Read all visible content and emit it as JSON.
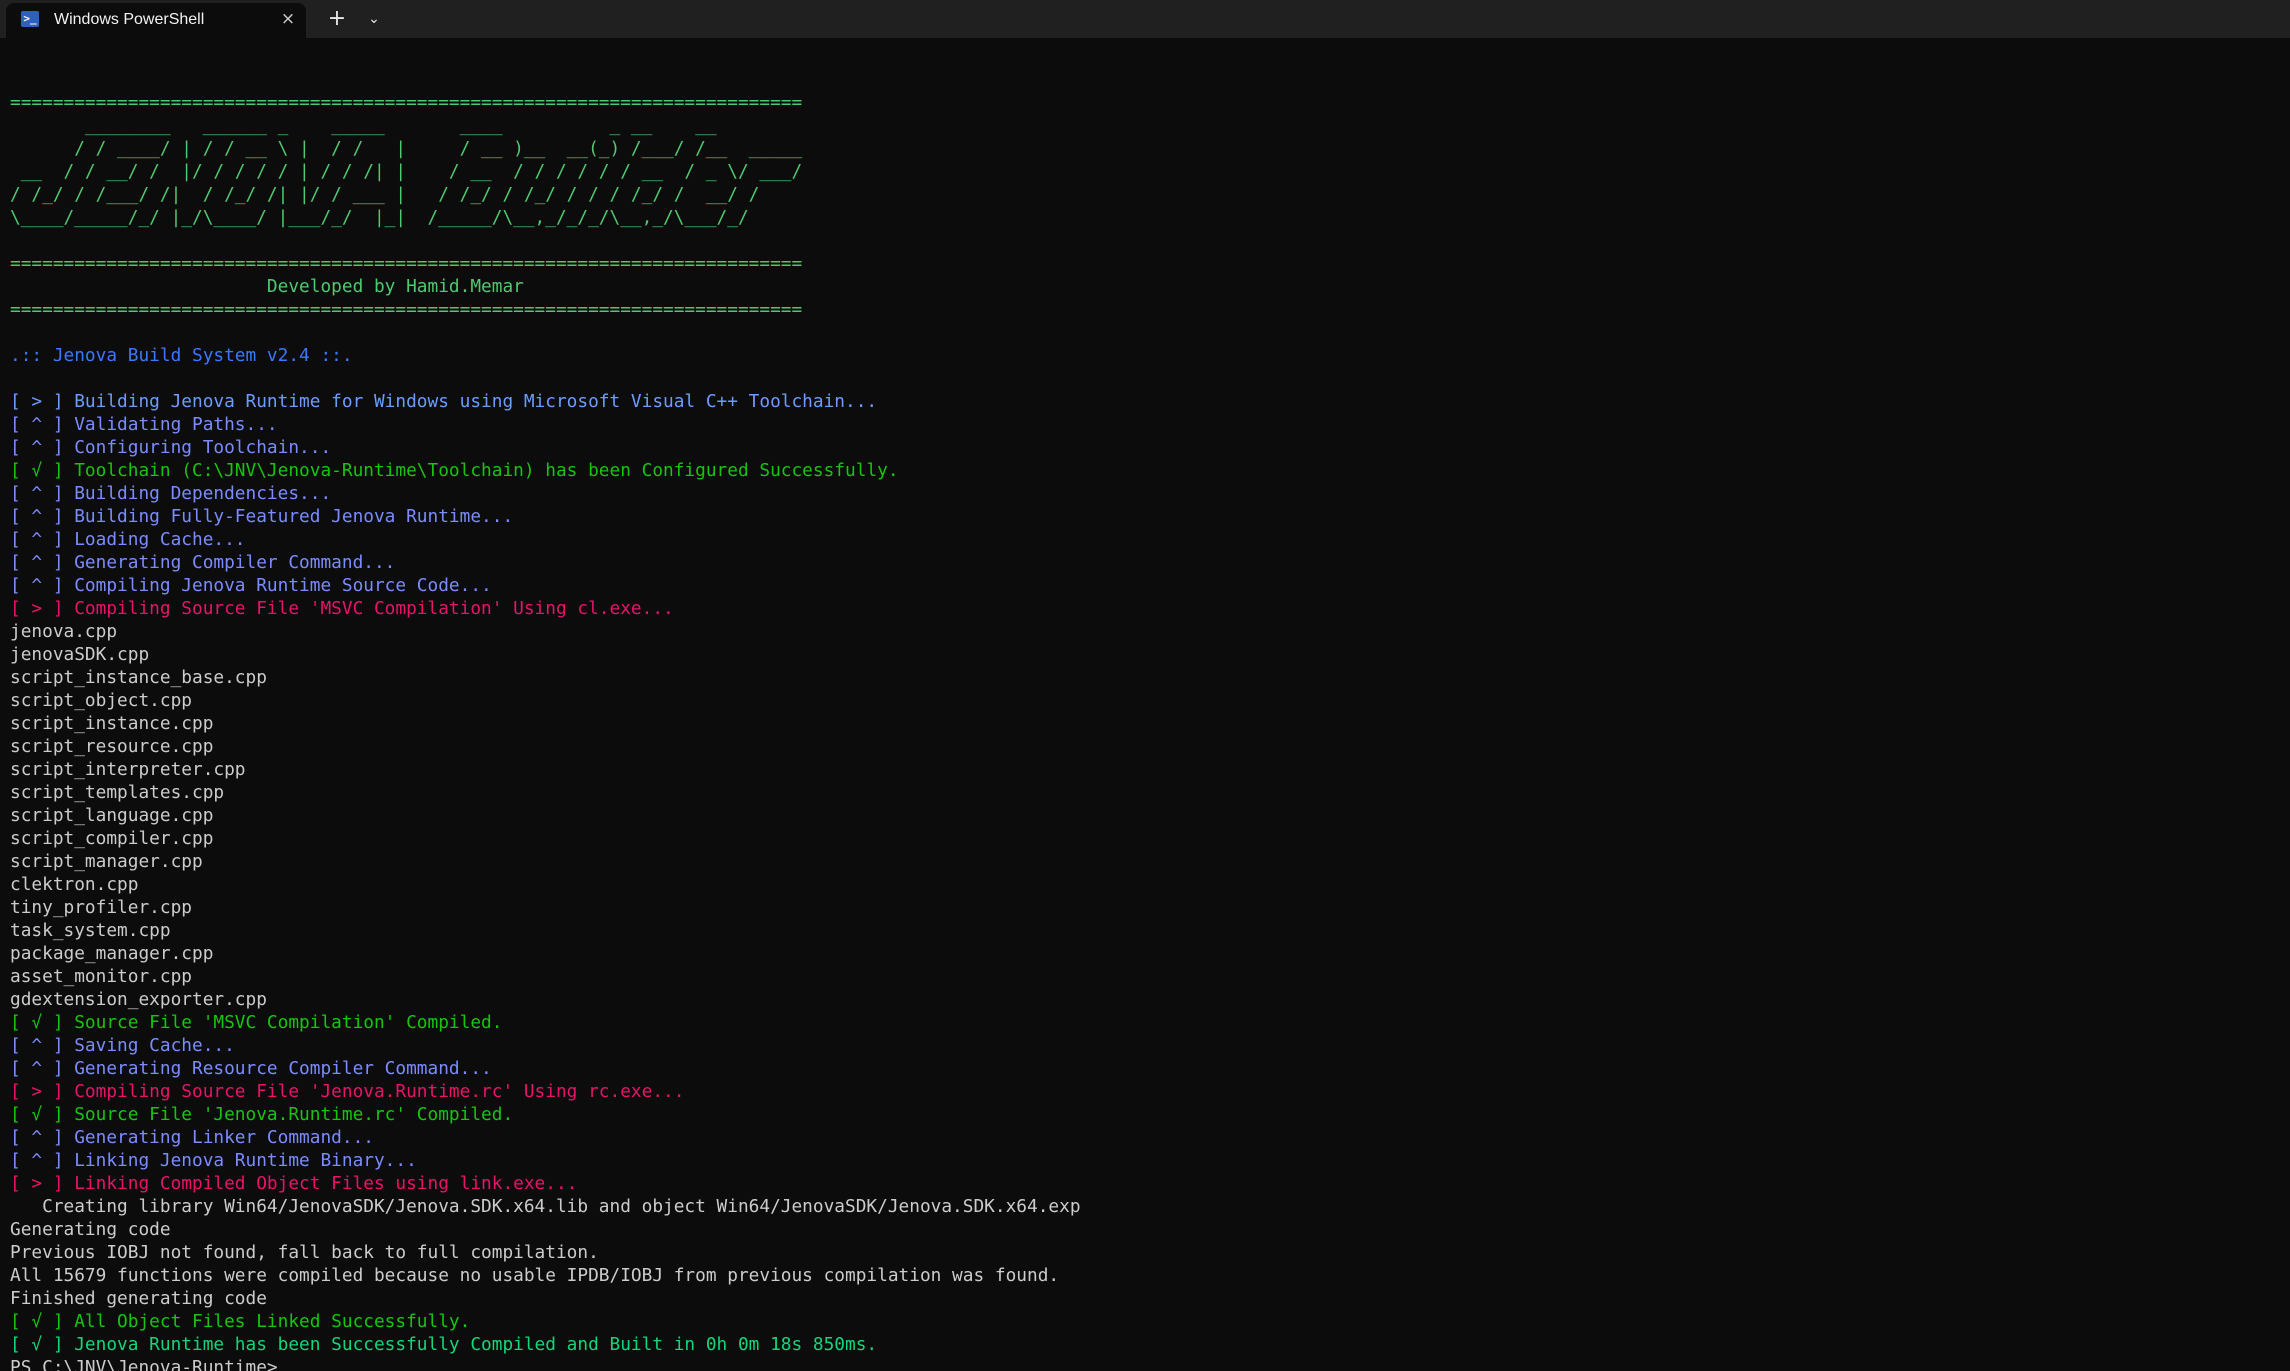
{
  "window": {
    "tab_title": "Windows PowerShell",
    "tab_icon": "powershell-icon",
    "close_icon": "×",
    "new_tab_icon": "+",
    "dropdown_icon": "⌄"
  },
  "colors": {
    "background": "#0c0c0c",
    "titlebar": "#202020",
    "banner": "#4ec96f",
    "title": "#3b78ff",
    "info": "#6d9cff",
    "step": "#7b8cff",
    "success": "#16c60c",
    "action": "#e8146a",
    "output": "#cccccc"
  },
  "terminal": {
    "lines": [
      {
        "t": "",
        "c": "c-out"
      },
      {
        "t": "==========================================================================",
        "c": "c-banner"
      },
      {
        "t": "       ________   ______ _    _____       ____          _ __    __",
        "c": "c-banner"
      },
      {
        "t": "      / / ____/ | / / __ \\ |  / /   |     / __ )__  __(_) /___/ /__  _____",
        "c": "c-banner"
      },
      {
        "t": " __  / / __/ /  |/ / / / / | / / /| |    / __  / / / / / / __  / _ \\/ ___/",
        "c": "c-banner"
      },
      {
        "t": "/ /_/ / /___/ /|  / /_/ /| |/ / ___ |   / /_/ / /_/ / / / /_/ /  __/ /",
        "c": "c-banner"
      },
      {
        "t": "\\____/_____/_/ |_/\\____/ |___/_/  |_|  /_____/\\__,_/_/_/\\__,_/\\___/_/",
        "c": "c-banner"
      },
      {
        "t": "",
        "c": "c-out"
      },
      {
        "t": "==========================================================================",
        "c": "c-banner"
      },
      {
        "t": "                        Developed by Hamid.Memar",
        "c": "c-credit"
      },
      {
        "t": "==========================================================================",
        "c": "c-banner"
      },
      {
        "t": "",
        "c": "c-out"
      },
      {
        "t": ".:: Jenova Build System v2.4 ::.",
        "c": "c-title"
      },
      {
        "t": "",
        "c": "c-out"
      },
      {
        "t": "[ > ] Building Jenova Runtime for Windows using Microsoft Visual C++ Toolchain...",
        "c": "c-info"
      },
      {
        "t": "[ ^ ] Validating Paths...",
        "c": "c-step"
      },
      {
        "t": "[ ^ ] Configuring Toolchain...",
        "c": "c-step"
      },
      {
        "t": "[ √ ] Toolchain (C:\\JNV\\Jenova-Runtime\\Toolchain) has been Configured Successfully.",
        "c": "c-ok"
      },
      {
        "t": "[ ^ ] Building Dependencies...",
        "c": "c-step"
      },
      {
        "t": "[ ^ ] Building Fully-Featured Jenova Runtime...",
        "c": "c-step"
      },
      {
        "t": "[ ^ ] Loading Cache...",
        "c": "c-step"
      },
      {
        "t": "[ ^ ] Generating Compiler Command...",
        "c": "c-step"
      },
      {
        "t": "[ ^ ] Compiling Jenova Runtime Source Code...",
        "c": "c-step"
      },
      {
        "t": "[ > ] Compiling Source File 'MSVC Compilation' Using cl.exe...",
        "c": "c-warn"
      },
      {
        "t": "jenova.cpp",
        "c": "c-out"
      },
      {
        "t": "jenovaSDK.cpp",
        "c": "c-out"
      },
      {
        "t": "script_instance_base.cpp",
        "c": "c-out"
      },
      {
        "t": "script_object.cpp",
        "c": "c-out"
      },
      {
        "t": "script_instance.cpp",
        "c": "c-out"
      },
      {
        "t": "script_resource.cpp",
        "c": "c-out"
      },
      {
        "t": "script_interpreter.cpp",
        "c": "c-out"
      },
      {
        "t": "script_templates.cpp",
        "c": "c-out"
      },
      {
        "t": "script_language.cpp",
        "c": "c-out"
      },
      {
        "t": "script_compiler.cpp",
        "c": "c-out"
      },
      {
        "t": "script_manager.cpp",
        "c": "c-out"
      },
      {
        "t": "clektron.cpp",
        "c": "c-out"
      },
      {
        "t": "tiny_profiler.cpp",
        "c": "c-out"
      },
      {
        "t": "task_system.cpp",
        "c": "c-out"
      },
      {
        "t": "package_manager.cpp",
        "c": "c-out"
      },
      {
        "t": "asset_monitor.cpp",
        "c": "c-out"
      },
      {
        "t": "gdextension_exporter.cpp",
        "c": "c-out"
      },
      {
        "t": "[ √ ] Source File 'MSVC Compilation' Compiled.",
        "c": "c-ok"
      },
      {
        "t": "[ ^ ] Saving Cache...",
        "c": "c-step"
      },
      {
        "t": "[ ^ ] Generating Resource Compiler Command...",
        "c": "c-step"
      },
      {
        "t": "[ > ] Compiling Source File 'Jenova.Runtime.rc' Using rc.exe...",
        "c": "c-warn"
      },
      {
        "t": "[ √ ] Source File 'Jenova.Runtime.rc' Compiled.",
        "c": "c-ok"
      },
      {
        "t": "[ ^ ] Generating Linker Command...",
        "c": "c-step"
      },
      {
        "t": "[ ^ ] Linking Jenova Runtime Binary...",
        "c": "c-step"
      },
      {
        "t": "[ > ] Linking Compiled Object Files using link.exe...",
        "c": "c-warn"
      },
      {
        "t": "   Creating library Win64/JenovaSDK/Jenova.SDK.x64.lib and object Win64/JenovaSDK/Jenova.SDK.x64.exp",
        "c": "c-out"
      },
      {
        "t": "Generating code",
        "c": "c-out"
      },
      {
        "t": "Previous IOBJ not found, fall back to full compilation.",
        "c": "c-out"
      },
      {
        "t": "All 15679 functions were compiled because no usable IPDB/IOBJ from previous compilation was found.",
        "c": "c-out"
      },
      {
        "t": "Finished generating code",
        "c": "c-out"
      },
      {
        "t": "[ √ ] All Object Files Linked Successfully.",
        "c": "c-ok"
      },
      {
        "t": "[ √ ] Jenova Runtime has been Successfully Compiled and Built in 0h 0m 18s 850ms.",
        "c": "c-ok2"
      },
      {
        "t": "PS C:\\JNV\\Jenova-Runtime>",
        "c": "c-prompt"
      }
    ]
  }
}
